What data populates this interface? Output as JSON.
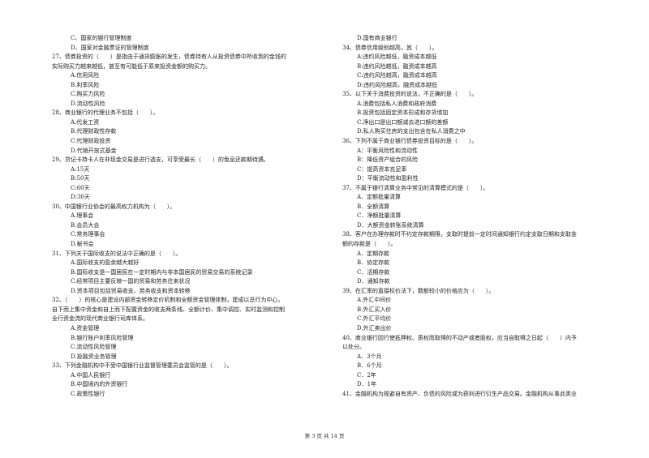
{
  "left_column": [
    {
      "type": "opt",
      "text": "C、国家的银行管理制度"
    },
    {
      "type": "opt",
      "text": "D、国家对金融票证的管理制度"
    },
    {
      "type": "q",
      "text": "27、债券投资的（　　）是指由于通货膨胀的发生，债券持有人从投资债券中所收到的金钱的"
    },
    {
      "type": "q",
      "text": "实际购买力越来越低，甚至有可能低于原来投资金额的购买力。"
    },
    {
      "type": "opt",
      "text": "A.信用风险"
    },
    {
      "type": "opt",
      "text": "B.利率风险"
    },
    {
      "type": "opt",
      "text": "C.购买力风险"
    },
    {
      "type": "opt",
      "text": "D.流动性风险"
    },
    {
      "type": "q",
      "text": "28、商业银行的代理业务不包括（　　）。"
    },
    {
      "type": "opt",
      "text": "A.代发工资"
    },
    {
      "type": "opt",
      "text": "B.代理财政性存款"
    },
    {
      "type": "opt",
      "text": "C.代理财政投资"
    },
    {
      "type": "opt",
      "text": "D.代销开放式基金"
    },
    {
      "type": "q",
      "text": "29、贷记卡持卡人在非现金交易是进行透支，可享受最长（　　）的免息还款期待遇。"
    },
    {
      "type": "opt",
      "text": "A:15天"
    },
    {
      "type": "opt",
      "text": "B:50天"
    },
    {
      "type": "opt",
      "text": "C:60天"
    },
    {
      "type": "opt",
      "text": "D:30天"
    },
    {
      "type": "q",
      "text": "30、中国银行业协会的最高权力机构为（　　）。"
    },
    {
      "type": "opt",
      "text": "A.理事会"
    },
    {
      "type": "opt",
      "text": "B.会员大会"
    },
    {
      "type": "opt",
      "text": "C.常务理事会"
    },
    {
      "type": "opt",
      "text": "D.秘书会"
    },
    {
      "type": "q",
      "text": "31、下列关于国际收支的说法中正确的是（　　）。"
    },
    {
      "type": "opt",
      "text": "A.国际收支的盈余越大越好"
    },
    {
      "type": "opt",
      "text": "B.国际收支是一国居民在一定时期内与非本国居民的贸易交易的系统记录"
    },
    {
      "type": "opt",
      "text": "C.经常项目主要反映一国的贸易和劳务往来状况"
    },
    {
      "type": "opt",
      "text": "D.资本项目包括贸易收支、劳务收支和资本转移"
    },
    {
      "type": "q",
      "text": "32、（　　）的核心是建设内部资金转移定价机制和全额资金管理体制，建成以总行为中心，"
    },
    {
      "type": "q",
      "text": "自下而上集中资金和自上而下配置资金的收支两条线、全额计价、集中调控、实时监测和控制"
    },
    {
      "type": "q",
      "text": "全行资金流的现代商业银行司库体系。"
    },
    {
      "type": "opt",
      "text": "A.资金管理"
    },
    {
      "type": "opt",
      "text": "B.银行账户利率风险管理"
    },
    {
      "type": "opt",
      "text": "C.流动性风险管理"
    },
    {
      "type": "opt",
      "text": "D.投融资业务管理"
    },
    {
      "type": "q",
      "text": "33、下列金融机构中不受中国银行业监督管理委员会监管的是（　　）。"
    },
    {
      "type": "opt",
      "text": "A.中国人民银行"
    },
    {
      "type": "opt",
      "text": "B.中国境内的外资银行"
    },
    {
      "type": "opt",
      "text": "C.政策性银行"
    }
  ],
  "right_column": [
    {
      "type": "opt",
      "text": "D.国有商业银行"
    },
    {
      "type": "q",
      "text": "34、债券信用级别越高，其（　　）。"
    },
    {
      "type": "opt",
      "text": "A:违约风险越低，融资成本越低"
    },
    {
      "type": "opt",
      "text": "B:违约风险越低，融资成本越高"
    },
    {
      "type": "opt",
      "text": "C:违约风险越高，融资成本越高"
    },
    {
      "type": "opt",
      "text": "D:违约风险越高，融资成本越低"
    },
    {
      "type": "q",
      "text": "35、以下关于消费投资的说法，不正确的是（　　）。"
    },
    {
      "type": "opt",
      "text": "A.消费包括私人消费和政府消费"
    },
    {
      "type": "opt",
      "text": "B.投资包括固定资本形成和存货增加"
    },
    {
      "type": "opt",
      "text": "C.净出口是出口额减去进口额的差额"
    },
    {
      "type": "opt",
      "text": "D.私人购买住房的支出包含在私人消费之中"
    },
    {
      "type": "q",
      "text": "36、下列不属于商业银行债券投资目标的是（　　）。"
    },
    {
      "type": "opt",
      "text": "A：平衡风险性和流动性"
    },
    {
      "type": "opt",
      "text": "B：降低资产组合的风险"
    },
    {
      "type": "opt",
      "text": "C：提高资本充足率"
    },
    {
      "type": "opt",
      "text": "D：平衡流动性和盈利性"
    },
    {
      "type": "q",
      "text": "37、不属于银行清算业务中常见的清算模式的是（　　）。"
    },
    {
      "type": "opt",
      "text": "A．定额批量清算"
    },
    {
      "type": "opt",
      "text": "B．全额清算"
    },
    {
      "type": "opt",
      "text": "C．净额批量清算"
    },
    {
      "type": "opt",
      "text": "D．大额资金转账系统清算"
    },
    {
      "type": "q",
      "text": "38、客户在办理存款时不约定存款期限，支取时提前一定时间通知银行约定支取日期和支取金"
    },
    {
      "type": "q",
      "text": "额的存款是（　　）。"
    },
    {
      "type": "opt",
      "text": "A．定期存款"
    },
    {
      "type": "opt",
      "text": "B．协定存款"
    },
    {
      "type": "opt",
      "text": "C．活期存款"
    },
    {
      "type": "opt",
      "text": "D．通知存款"
    },
    {
      "type": "q",
      "text": "39、在汇率的直接标价法下，数额较小的价格应为（　　）。"
    },
    {
      "type": "opt",
      "text": "A.外汇中间价"
    },
    {
      "type": "opt",
      "text": "B.外汇买入价"
    },
    {
      "type": "opt",
      "text": "C.外汇平均价"
    },
    {
      "type": "opt",
      "text": "D.外汇卖出价"
    },
    {
      "type": "q",
      "text": "40、商业银行因行使抵押权、质权而取得的不动产或者股权，应当自取得之日起（　　）内予"
    },
    {
      "type": "q",
      "text": "以处分。"
    },
    {
      "type": "opt",
      "text": "A．3个月"
    },
    {
      "type": "opt",
      "text": "B．6个月"
    },
    {
      "type": "opt",
      "text": "C．2年"
    },
    {
      "type": "opt",
      "text": "D．1年"
    },
    {
      "type": "q",
      "text": "41、金融机构为规避自有资产、负债的风险或为获利进行衍生产品交易。金融机构从事此类业"
    }
  ],
  "footer": {
    "page_label": "第 3 页 共 14 页"
  }
}
